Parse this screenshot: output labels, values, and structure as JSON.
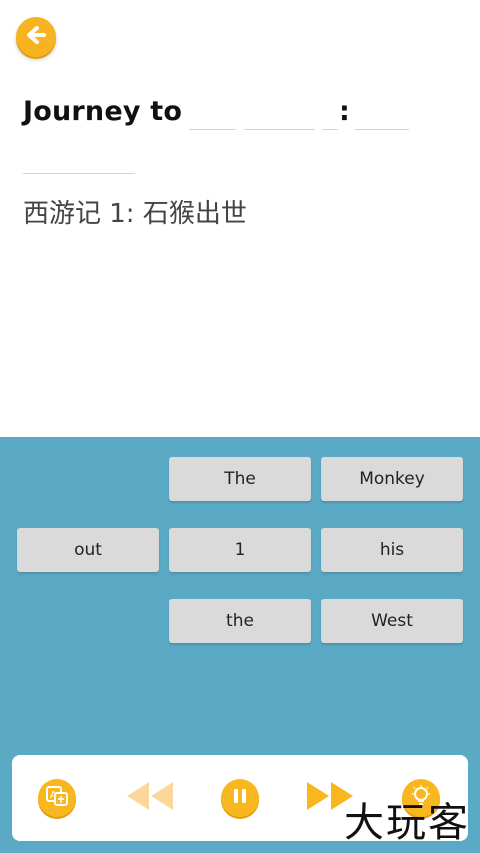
{
  "header": {
    "back_icon": "arrow-left-icon"
  },
  "puzzle": {
    "prefix": "Journey to",
    "colon": ":",
    "translation": "西游记 1: 石猴出世"
  },
  "word_bank": {
    "tiles": [
      {
        "label": "The"
      },
      {
        "label": "Monkey"
      },
      {
        "label": "out"
      },
      {
        "label": "1"
      },
      {
        "label": "his"
      },
      {
        "label": "the"
      },
      {
        "label": "West"
      }
    ]
  },
  "controls": {
    "translate_icon": "translate-icon",
    "rewind_icon": "rewind-icon",
    "pause_icon": "pause-icon",
    "fast_forward_icon": "fast-forward-icon",
    "hint_icon": "lightbulb-icon"
  },
  "watermark": {
    "text": "大玩客"
  },
  "colors": {
    "accent": "#f7b320",
    "bank_background": "#5aaac5",
    "tile_background": "#d9dad9"
  }
}
